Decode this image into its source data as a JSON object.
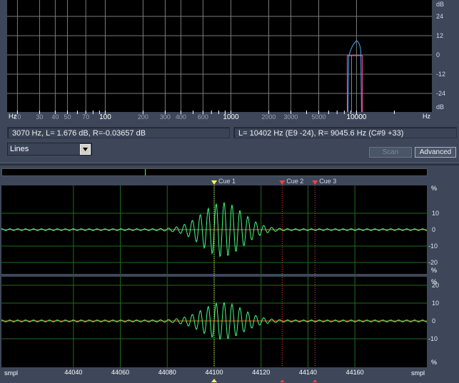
{
  "spectrum": {
    "db_unit": "dB",
    "db_ticks": [
      "24",
      "12",
      "0",
      "-12",
      "-24"
    ],
    "freq_unit": "Hz",
    "freq_ticks": [
      {
        "f": 20,
        "label": "20"
      },
      {
        "f": 30,
        "label": "30"
      },
      {
        "f": 40,
        "label": "40"
      },
      {
        "f": 50,
        "label": "50"
      },
      {
        "f": 70,
        "label": "70"
      },
      {
        "f": 100,
        "label": "100"
      },
      {
        "f": 200,
        "label": "200"
      },
      {
        "f": 300,
        "label": "300"
      },
      {
        "f": 400,
        "label": "400"
      },
      {
        "f": 600,
        "label": "600"
      },
      {
        "f": 1000,
        "label": "1000"
      },
      {
        "f": 2000,
        "label": "2000"
      },
      {
        "f": 3000,
        "label": "3000"
      },
      {
        "f": 5000,
        "label": "5000"
      },
      {
        "f": 10000,
        "label": "10000"
      }
    ],
    "colors": {
      "left": "#4fa9ff",
      "right": "#ff4fa0",
      "grid": "#7a7a7a"
    }
  },
  "status": {
    "cursor": "3070 Hz, L= 1.676 dB, R=-0.03657 dB",
    "peak": "L=  10402 Hz (E9 -24), R= 9045.6 Hz (C#9 +33)"
  },
  "controls": {
    "view_mode": "Lines",
    "scan_label": "Scan",
    "advanced_label": "Advanced"
  },
  "waveform": {
    "cues": [
      {
        "label": "Cue 1",
        "sample": 44100,
        "color": "#ffff40"
      },
      {
        "label": "Cue 2",
        "sample": 44129,
        "color": "#ff4040"
      },
      {
        "label": "Cue 3",
        "sample": 44143,
        "color": "#ff4040"
      }
    ],
    "x_unit": "smpl",
    "x_ticks": [
      "44040",
      "44060",
      "44080",
      "44100",
      "44120",
      "44140",
      "44160"
    ],
    "ch1_unit": "%",
    "ch1_ticks": [
      "10",
      "0",
      "-10",
      "-20"
    ],
    "ch2_unit": "%",
    "ch2_ticks": [
      "20",
      "10",
      "0",
      "-10"
    ],
    "colors": {
      "wave": "#40ff80",
      "grid": "#1f6d1f",
      "zero": "#ff6020"
    }
  }
}
